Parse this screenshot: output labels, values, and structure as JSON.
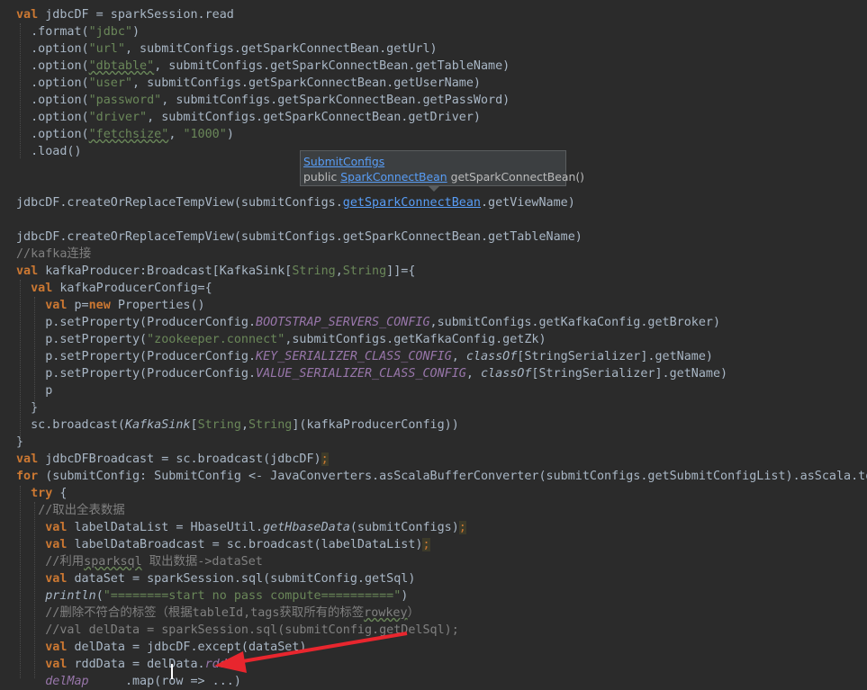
{
  "editor": {
    "code_lines": [
      {
        "segments": [
          {
            "t": "val",
            "c": "kw"
          },
          {
            "t": " jdbcDF = sparkSession.read"
          }
        ]
      },
      {
        "segments": [
          {
            "t": "  .format("
          },
          {
            "t": "\"jdbc\"",
            "c": "str"
          },
          {
            "t": ")"
          }
        ]
      },
      {
        "segments": [
          {
            "t": "  .option("
          },
          {
            "t": "\"url\"",
            "c": "str"
          },
          {
            "t": ", submitConfigs.getSparkConnectBean.getUrl)"
          }
        ]
      },
      {
        "segments": [
          {
            "t": "  .option("
          },
          {
            "t": "\"dbtable\"",
            "c": "str wavy"
          },
          {
            "t": ", submitConfigs.getSparkConnectBean.getTableName)"
          }
        ]
      },
      {
        "segments": [
          {
            "t": "  .option("
          },
          {
            "t": "\"user\"",
            "c": "str"
          },
          {
            "t": ", submitConfigs.getSparkConnectBean.getUserName)"
          }
        ]
      },
      {
        "segments": [
          {
            "t": "  .option("
          },
          {
            "t": "\"password\"",
            "c": "str"
          },
          {
            "t": ", submitConfigs.getSparkConnectBean.getPassWord)"
          }
        ]
      },
      {
        "segments": [
          {
            "t": "  .option("
          },
          {
            "t": "\"driver\"",
            "c": "str"
          },
          {
            "t": ", submitConfigs.getSparkConnectBean.getDriver)"
          }
        ]
      },
      {
        "segments": [
          {
            "t": "  .option("
          },
          {
            "t": "\"fetchsize\"",
            "c": "str wavy"
          },
          {
            "t": ", "
          },
          {
            "t": "\"1000\"",
            "c": "str"
          },
          {
            "t": ")"
          }
        ]
      },
      {
        "segments": [
          {
            "t": "  .load()"
          }
        ]
      },
      {
        "segments": []
      },
      {
        "segments": []
      },
      {
        "segments": [
          {
            "t": "jdbcDF.createOrReplaceTempView(submitConfigs."
          },
          {
            "t": "getSparkConnectBean",
            "c": "link"
          },
          {
            "t": ".getViewName)"
          }
        ]
      },
      {
        "segments": []
      },
      {
        "segments": [
          {
            "t": "jdbcDF.createOrReplaceTempView(submitConfigs.getSparkConnectBean.getTableName)"
          }
        ]
      },
      {
        "segments": [
          {
            "t": "//kafka连接",
            "c": "cmt"
          }
        ]
      },
      {
        "segments": [
          {
            "t": "val",
            "c": "kw"
          },
          {
            "t": " kafkaProducer:Broadcast[KafkaSink["
          },
          {
            "t": "String",
            "c": "typ"
          },
          {
            "t": ","
          },
          {
            "t": "String",
            "c": "typ"
          },
          {
            "t": "]]={"
          }
        ]
      },
      {
        "segments": [
          {
            "t": "  "
          },
          {
            "t": "val",
            "c": "kw"
          },
          {
            "t": " kafkaProducerConfig={"
          }
        ]
      },
      {
        "segments": [
          {
            "t": "    "
          },
          {
            "t": "val",
            "c": "kw"
          },
          {
            "t": " p="
          },
          {
            "t": "new",
            "c": "kw"
          },
          {
            "t": " Properties()"
          }
        ]
      },
      {
        "segments": [
          {
            "t": "    p.setProperty(ProducerConfig."
          },
          {
            "t": "BOOTSTRAP_SERVERS_CONFIG",
            "c": "it"
          },
          {
            "t": ",submitConfigs.getKafkaConfig.getBroker)"
          }
        ]
      },
      {
        "segments": [
          {
            "t": "    p.setProperty("
          },
          {
            "t": "\"zookeeper.connect\"",
            "c": "str"
          },
          {
            "t": ",submitConfigs.getKafkaConfig.getZk)"
          }
        ]
      },
      {
        "segments": [
          {
            "t": "    p.setProperty(ProducerConfig."
          },
          {
            "t": "KEY_SERIALIZER_CLASS_CONFIG",
            "c": "it"
          },
          {
            "t": ", "
          },
          {
            "t": "classOf",
            "c": "itw"
          },
          {
            "t": "[StringSerializer].getName)"
          }
        ]
      },
      {
        "segments": [
          {
            "t": "    p.setProperty(ProducerConfig."
          },
          {
            "t": "VALUE_SERIALIZER_CLASS_CONFIG",
            "c": "it"
          },
          {
            "t": ", "
          },
          {
            "t": "classOf",
            "c": "itw"
          },
          {
            "t": "[StringSerializer].getName)"
          }
        ]
      },
      {
        "segments": [
          {
            "t": "    p"
          }
        ]
      },
      {
        "segments": [
          {
            "t": "  }"
          }
        ]
      },
      {
        "segments": [
          {
            "t": "  sc.broadcast("
          },
          {
            "t": "KafkaSink",
            "c": "itw"
          },
          {
            "t": "["
          },
          {
            "t": "String",
            "c": "typ"
          },
          {
            "t": ","
          },
          {
            "t": "String",
            "c": "typ"
          },
          {
            "t": "](kafkaProducerConfig))"
          }
        ]
      },
      {
        "segments": [
          {
            "t": "}"
          }
        ]
      },
      {
        "segments": [
          {
            "t": "val",
            "c": "kw"
          },
          {
            "t": " jdbcDFBroadcast = sc.broadcast(jdbcDF)"
          },
          {
            "t": ";",
            "c": "semi"
          }
        ]
      },
      {
        "segments": [
          {
            "t": "for",
            "c": "kw"
          },
          {
            "t": " (submitConfig: SubmitConfig <- JavaConverters.asScalaBufferConverter(submitConfigs.getSubmitConfigList).asScala.to"
          }
        ]
      },
      {
        "segments": [
          {
            "t": "  "
          },
          {
            "t": "try",
            "c": "kw"
          },
          {
            "t": " {"
          }
        ]
      },
      {
        "segments": [
          {
            "t": "   "
          },
          {
            "t": "//取出全表数据",
            "c": "cmt"
          }
        ]
      },
      {
        "segments": [
          {
            "t": "    "
          },
          {
            "t": "val",
            "c": "kw"
          },
          {
            "t": " labelDataList = HbaseUtil."
          },
          {
            "t": "getHbaseData",
            "c": "itw"
          },
          {
            "t": "(submitConfigs)"
          },
          {
            "t": ";",
            "c": "semi"
          }
        ]
      },
      {
        "segments": [
          {
            "t": "    "
          },
          {
            "t": "val",
            "c": "kw"
          },
          {
            "t": " labelDataBroadcast = sc.broadcast(labelDataList)"
          },
          {
            "t": ";",
            "c": "semi"
          }
        ]
      },
      {
        "segments": [
          {
            "t": "    "
          },
          {
            "t": "//利用",
            "c": "cmt"
          },
          {
            "t": "sparksql",
            "c": "cmt wavy"
          },
          {
            "t": " 取出数据->dataSet",
            "c": "cmt"
          }
        ]
      },
      {
        "segments": [
          {
            "t": "    "
          },
          {
            "t": "val",
            "c": "kw"
          },
          {
            "t": " dataSet = sparkSession.sql(submitConfig.getSql)"
          }
        ]
      },
      {
        "segments": [
          {
            "t": "    "
          },
          {
            "t": "println",
            "c": "itw"
          },
          {
            "t": "("
          },
          {
            "t": "\"========start no pass compute==========\"",
            "c": "str"
          },
          {
            "t": ")"
          }
        ]
      },
      {
        "segments": [
          {
            "t": "    "
          },
          {
            "t": "//删除不符合的标签（根据tableId,tags获取所有的标签",
            "c": "cmt"
          },
          {
            "t": "rowkey",
            "c": "cmt wavy"
          },
          {
            "t": "）",
            "c": "cmt"
          }
        ]
      },
      {
        "segments": [
          {
            "t": "    "
          },
          {
            "t": "//val delData = sparkSession.sql(submitConfig.getDelSql);",
            "c": "cmt"
          }
        ]
      },
      {
        "segments": [
          {
            "t": "    "
          },
          {
            "t": "val",
            "c": "kw"
          },
          {
            "t": " delData = jdbcDF.except(dataSet)"
          }
        ]
      },
      {
        "segments": [
          {
            "t": "    "
          },
          {
            "t": "val",
            "c": "kw"
          },
          {
            "t": " rddData = delData."
          },
          {
            "t": "rdd",
            "c": "it"
          }
        ]
      },
      {
        "segments": [
          {
            "t": "    "
          },
          {
            "t": "delMap",
            "c": "it"
          },
          {
            "t": "     "
          },
          {
            "t": ".map(row => ...)"
          }
        ]
      }
    ]
  },
  "tooltip": {
    "class_link": "SubmitConfigs",
    "modifier": "public",
    "type_link": "SparkConnectBean",
    "method": "getSparkConnectBean()"
  },
  "colors": {
    "background": "#2b2b2b",
    "keyword": "#cc7832",
    "string": "#6a8759",
    "comment": "#808080",
    "constant": "#9876aa",
    "link": "#589df6",
    "annotation_arrow": "#e8262e"
  }
}
